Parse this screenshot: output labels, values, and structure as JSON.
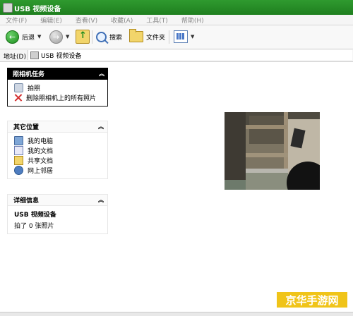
{
  "window": {
    "title": "USB 视频设备"
  },
  "menu": [
    "文件(F)",
    "编辑(E)",
    "查看(V)",
    "收藏(A)",
    "工具(T)",
    "帮助(H)"
  ],
  "toolbar": {
    "back_label": "后退",
    "search_label": "搜索",
    "folders_label": "文件夹"
  },
  "address": {
    "label": "地址(D)",
    "value": "USB 视频设备"
  },
  "camera_tasks": {
    "title": "照相机任务",
    "items": [
      {
        "label": "拍照",
        "icon": "camera-icon"
      },
      {
        "label": "删除照相机上的所有照片",
        "icon": "delete-icon"
      }
    ]
  },
  "other_places": {
    "title": "其它位置",
    "items": [
      {
        "label": "我的电脑",
        "icon": "computer-icon"
      },
      {
        "label": "我的文档",
        "icon": "documents-icon"
      },
      {
        "label": "共享文档",
        "icon": "shared-folder-icon"
      },
      {
        "label": "网上邻居",
        "icon": "network-icon"
      }
    ]
  },
  "details": {
    "title": "详细信息",
    "name": "USB 视频设备",
    "count": "拍了 0 张照片"
  },
  "watermark": {
    "text": "京华手游网"
  },
  "colors": {
    "titlebar": "#2f9a2f",
    "watermark": "#f0c419"
  }
}
